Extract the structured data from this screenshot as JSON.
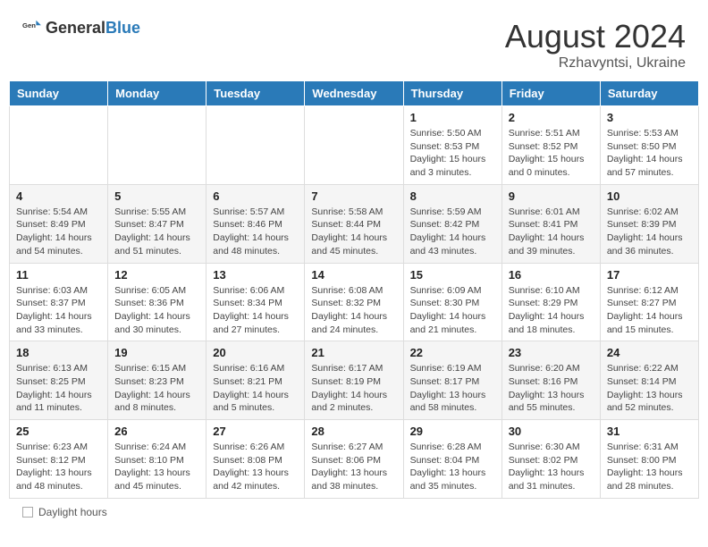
{
  "header": {
    "logo_general": "General",
    "logo_blue": "Blue",
    "month_year": "August 2024",
    "location": "Rzhavyntsi, Ukraine"
  },
  "footer": {
    "daylight_label": "Daylight hours"
  },
  "days_of_week": [
    "Sunday",
    "Monday",
    "Tuesday",
    "Wednesday",
    "Thursday",
    "Friday",
    "Saturday"
  ],
  "weeks": [
    {
      "row_shade": "light",
      "days": [
        {
          "date": "",
          "info": ""
        },
        {
          "date": "",
          "info": ""
        },
        {
          "date": "",
          "info": ""
        },
        {
          "date": "",
          "info": ""
        },
        {
          "date": "1",
          "info": "Sunrise: 5:50 AM\nSunset: 8:53 PM\nDaylight: 15 hours\nand 3 minutes."
        },
        {
          "date": "2",
          "info": "Sunrise: 5:51 AM\nSunset: 8:52 PM\nDaylight: 15 hours\nand 0 minutes."
        },
        {
          "date": "3",
          "info": "Sunrise: 5:53 AM\nSunset: 8:50 PM\nDaylight: 14 hours\nand 57 minutes."
        }
      ]
    },
    {
      "row_shade": "dark",
      "days": [
        {
          "date": "4",
          "info": "Sunrise: 5:54 AM\nSunset: 8:49 PM\nDaylight: 14 hours\nand 54 minutes."
        },
        {
          "date": "5",
          "info": "Sunrise: 5:55 AM\nSunset: 8:47 PM\nDaylight: 14 hours\nand 51 minutes."
        },
        {
          "date": "6",
          "info": "Sunrise: 5:57 AM\nSunset: 8:46 PM\nDaylight: 14 hours\nand 48 minutes."
        },
        {
          "date": "7",
          "info": "Sunrise: 5:58 AM\nSunset: 8:44 PM\nDaylight: 14 hours\nand 45 minutes."
        },
        {
          "date": "8",
          "info": "Sunrise: 5:59 AM\nSunset: 8:42 PM\nDaylight: 14 hours\nand 43 minutes."
        },
        {
          "date": "9",
          "info": "Sunrise: 6:01 AM\nSunset: 8:41 PM\nDaylight: 14 hours\nand 39 minutes."
        },
        {
          "date": "10",
          "info": "Sunrise: 6:02 AM\nSunset: 8:39 PM\nDaylight: 14 hours\nand 36 minutes."
        }
      ]
    },
    {
      "row_shade": "light",
      "days": [
        {
          "date": "11",
          "info": "Sunrise: 6:03 AM\nSunset: 8:37 PM\nDaylight: 14 hours\nand 33 minutes."
        },
        {
          "date": "12",
          "info": "Sunrise: 6:05 AM\nSunset: 8:36 PM\nDaylight: 14 hours\nand 30 minutes."
        },
        {
          "date": "13",
          "info": "Sunrise: 6:06 AM\nSunset: 8:34 PM\nDaylight: 14 hours\nand 27 minutes."
        },
        {
          "date": "14",
          "info": "Sunrise: 6:08 AM\nSunset: 8:32 PM\nDaylight: 14 hours\nand 24 minutes."
        },
        {
          "date": "15",
          "info": "Sunrise: 6:09 AM\nSunset: 8:30 PM\nDaylight: 14 hours\nand 21 minutes."
        },
        {
          "date": "16",
          "info": "Sunrise: 6:10 AM\nSunset: 8:29 PM\nDaylight: 14 hours\nand 18 minutes."
        },
        {
          "date": "17",
          "info": "Sunrise: 6:12 AM\nSunset: 8:27 PM\nDaylight: 14 hours\nand 15 minutes."
        }
      ]
    },
    {
      "row_shade": "dark",
      "days": [
        {
          "date": "18",
          "info": "Sunrise: 6:13 AM\nSunset: 8:25 PM\nDaylight: 14 hours\nand 11 minutes."
        },
        {
          "date": "19",
          "info": "Sunrise: 6:15 AM\nSunset: 8:23 PM\nDaylight: 14 hours\nand 8 minutes."
        },
        {
          "date": "20",
          "info": "Sunrise: 6:16 AM\nSunset: 8:21 PM\nDaylight: 14 hours\nand 5 minutes."
        },
        {
          "date": "21",
          "info": "Sunrise: 6:17 AM\nSunset: 8:19 PM\nDaylight: 14 hours\nand 2 minutes."
        },
        {
          "date": "22",
          "info": "Sunrise: 6:19 AM\nSunset: 8:17 PM\nDaylight: 13 hours\nand 58 minutes."
        },
        {
          "date": "23",
          "info": "Sunrise: 6:20 AM\nSunset: 8:16 PM\nDaylight: 13 hours\nand 55 minutes."
        },
        {
          "date": "24",
          "info": "Sunrise: 6:22 AM\nSunset: 8:14 PM\nDaylight: 13 hours\nand 52 minutes."
        }
      ]
    },
    {
      "row_shade": "light",
      "days": [
        {
          "date": "25",
          "info": "Sunrise: 6:23 AM\nSunset: 8:12 PM\nDaylight: 13 hours\nand 48 minutes."
        },
        {
          "date": "26",
          "info": "Sunrise: 6:24 AM\nSunset: 8:10 PM\nDaylight: 13 hours\nand 45 minutes."
        },
        {
          "date": "27",
          "info": "Sunrise: 6:26 AM\nSunset: 8:08 PM\nDaylight: 13 hours\nand 42 minutes."
        },
        {
          "date": "28",
          "info": "Sunrise: 6:27 AM\nSunset: 8:06 PM\nDaylight: 13 hours\nand 38 minutes."
        },
        {
          "date": "29",
          "info": "Sunrise: 6:28 AM\nSunset: 8:04 PM\nDaylight: 13 hours\nand 35 minutes."
        },
        {
          "date": "30",
          "info": "Sunrise: 6:30 AM\nSunset: 8:02 PM\nDaylight: 13 hours\nand 31 minutes."
        },
        {
          "date": "31",
          "info": "Sunrise: 6:31 AM\nSunset: 8:00 PM\nDaylight: 13 hours\nand 28 minutes."
        }
      ]
    }
  ]
}
